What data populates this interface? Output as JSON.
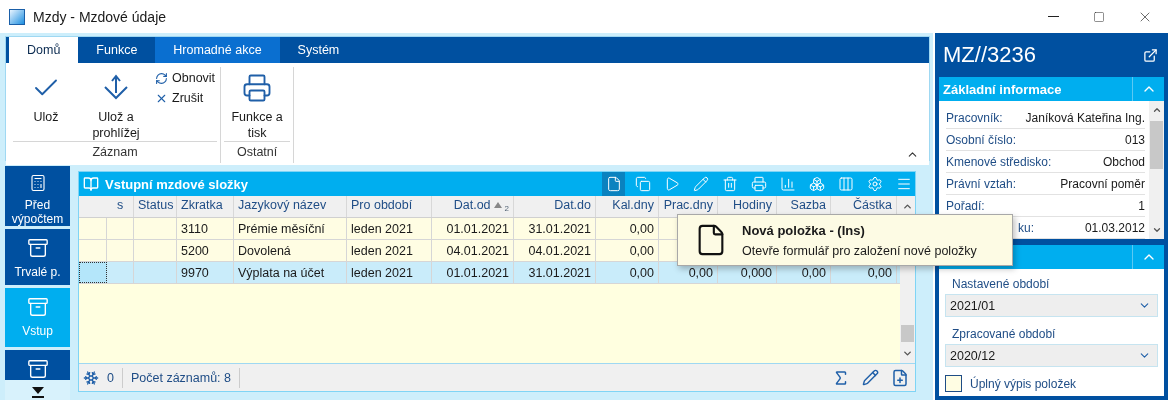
{
  "window": {
    "title": "Mzdy - Mzdové údaje"
  },
  "ribbon": {
    "tabs": [
      {
        "label": "Domů",
        "selected": true,
        "highlighted": false
      },
      {
        "label": "Funkce",
        "selected": false,
        "highlighted": false
      },
      {
        "label": "Hromadné akce",
        "selected": false,
        "highlighted": true
      },
      {
        "label": "Systém",
        "selected": false,
        "highlighted": false
      }
    ],
    "groups": [
      {
        "label": "Záznam",
        "buttons": [
          {
            "kind": "large",
            "label": "Ulož"
          },
          {
            "kind": "large",
            "label": "Ulož a prohlížej"
          },
          {
            "kind": "small",
            "label": "Obnovit"
          },
          {
            "kind": "small",
            "label": "Zrušit"
          }
        ]
      },
      {
        "label": "Ostatní",
        "buttons": [
          {
            "kind": "large",
            "label": "Funkce a tisk"
          }
        ]
      }
    ]
  },
  "nav": [
    {
      "label": "Před výpočtem",
      "selected": false
    },
    {
      "label": "Trvalé p.",
      "selected": false
    },
    {
      "label": "Vstup",
      "selected": true
    },
    {
      "selected": false
    }
  ],
  "grid": {
    "title": "Vstupní mzdové složky",
    "toolbar": [
      {
        "hovered": true
      },
      {
        "hovered": false
      },
      {
        "hovered": false
      },
      {
        "hovered": false
      },
      {
        "hovered": false
      },
      {
        "hovered": false
      },
      {
        "hovered": false
      },
      {
        "hovered": false
      },
      {
        "hovered": false
      },
      {
        "hovered": false
      },
      {
        "hovered": false
      }
    ],
    "columns": [
      {
        "label": "s"
      },
      {
        "label": "Status"
      },
      {
        "label": "Zkratka"
      },
      {
        "label": "Jazykový název"
      },
      {
        "label": "Pro období"
      },
      {
        "label": "Dat.od",
        "sort_ascending": true,
        "sort_rank": "2"
      },
      {
        "label": "Dat.do"
      },
      {
        "label": "Kal.dny"
      },
      {
        "label": "Prac.dny"
      },
      {
        "label": "Hodiny"
      },
      {
        "label": "Sazba"
      },
      {
        "label": "Částka"
      }
    ],
    "rows": [
      {
        "selected": false,
        "cells": [
          null,
          null,
          "3110",
          "Prémie měsíční",
          "leden 2021",
          "01.01.2021",
          "31.01.2021",
          "0,00"
        ]
      },
      {
        "selected": false,
        "cells": [
          null,
          null,
          "5200",
          "Dovolená",
          "leden 2021",
          "04.01.2021",
          "04.01.2021",
          "0,00"
        ]
      },
      {
        "selected": true,
        "cells": [
          null,
          null,
          "9970",
          "Výplata na účet",
          "leden 2021",
          "01.01.2021",
          "31.01.2021",
          "0,00",
          "0,00",
          "0,000",
          "0,00",
          "0,00"
        ]
      }
    ],
    "footer": {
      "count": "0",
      "records": "Počet záznamů: 8"
    }
  },
  "tooltip": {
    "title": "Nová položka - (Ins)",
    "text": "Otevře formulář pro založení nové položky"
  },
  "panel": {
    "title": "MZ//3236",
    "sections": [
      {
        "title": "Základní informace",
        "expanded": true,
        "fields": [
          {
            "kind": "plain",
            "label": "Pracovník:",
            "value": "Janíková Kateřina Ing."
          },
          {
            "kind": "plain",
            "label": "Osobní číslo:",
            "value": "013"
          },
          {
            "kind": "plain",
            "label": "Kmenové středisko:",
            "value": "Obchod"
          },
          {
            "kind": "plain",
            "label": "Právní vztah:",
            "value": "Pracovní poměr"
          },
          {
            "kind": "plain",
            "label": "Pořadí:",
            "value": "1"
          },
          {
            "kind": "clipped",
            "label": "ku:",
            "value": "01.03.2012"
          }
        ]
      },
      {
        "expanded": true,
        "inputs": [
          {
            "label": "Nastavené období",
            "value": "2021/01"
          },
          {
            "label": "Zpracované období",
            "value": "2020/12"
          }
        ],
        "checkbox": {
          "label": "Úplný výpis položek",
          "checked": false
        }
      }
    ]
  }
}
